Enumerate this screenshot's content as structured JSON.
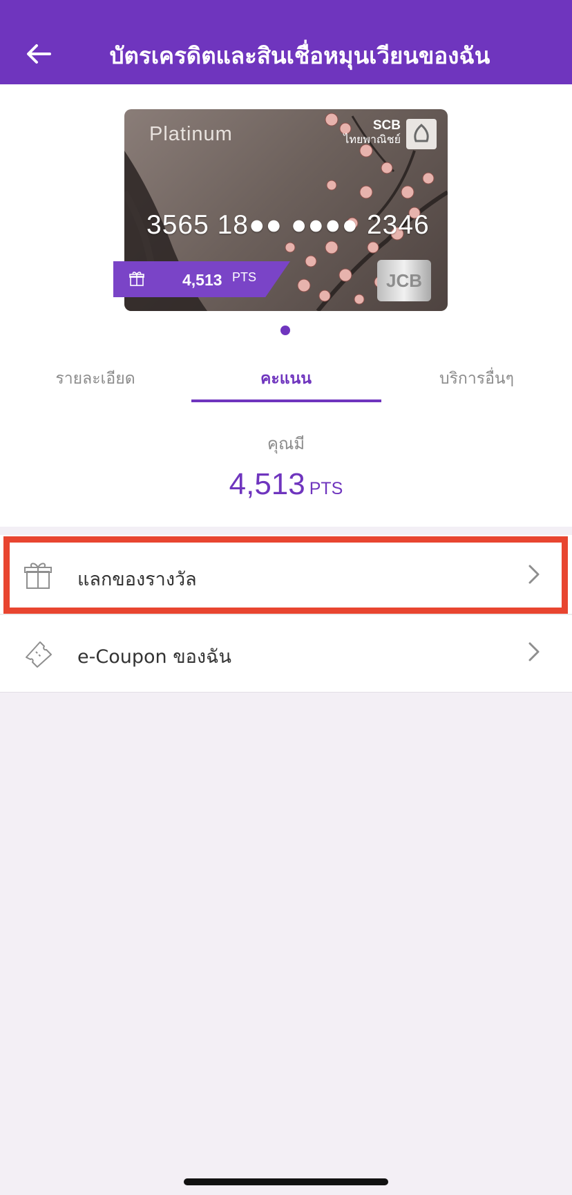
{
  "header": {
    "title": "บัตรเครดิตและสินเชื่อหมุนเวียนของฉัน",
    "back_icon": "arrow-left-icon",
    "background": "#6f35be"
  },
  "card": {
    "tier": "Platinum",
    "bank_name": "SCB",
    "bank_name_thai": "ไทยพาณิชย์",
    "number": "3565 18●● ●●●● 2346",
    "network": "JCB",
    "points_tag": {
      "value": "4,513",
      "unit": "PTS",
      "icon": "gift-icon"
    }
  },
  "pagination": {
    "current": 1,
    "total": 1
  },
  "tabs": [
    {
      "label": "รายละเอียด",
      "active": false
    },
    {
      "label": "คะแนน",
      "active": true
    },
    {
      "label": "บริการอื่นๆ",
      "active": false
    }
  ],
  "points": {
    "caption": "คุณมี",
    "value": "4,513",
    "unit": "PTS"
  },
  "menu": [
    {
      "label": "แลกของรางวัล",
      "icon": "gift-icon",
      "highlighted": true
    },
    {
      "label": "e-Coupon ของฉัน",
      "icon": "ticket-icon",
      "highlighted": false
    }
  ],
  "colors": {
    "accent": "#6f35be",
    "highlight": "#e84530",
    "background": "#f3eff5"
  }
}
